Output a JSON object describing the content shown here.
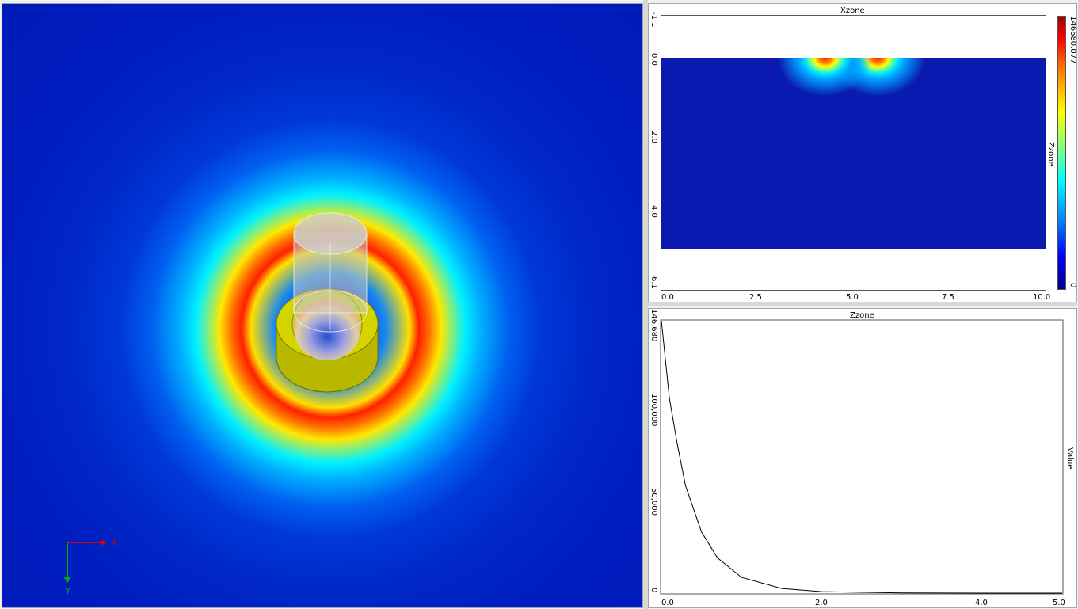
{
  "viewport": {
    "axis_x_label": "X",
    "axis_y_label": "Y",
    "colors": {
      "x_axis": "#e00000",
      "y_axis": "#00b000",
      "ring": "#d4d400"
    }
  },
  "top_plot": {
    "title": "Xzone",
    "right_axis_label": "Zzone",
    "x_ticks": [
      "0.0",
      "2.5",
      "5.0",
      "7.5",
      "10.0"
    ],
    "y_ticks": [
      "-1.1",
      "0.0",
      "2.0",
      "4.0",
      "6.1"
    ],
    "colorbar_max": "146680.077",
    "colorbar_min": "0"
  },
  "bottom_plot": {
    "title": "Zzone",
    "ylabel": "Value",
    "x_ticks": [
      "0.0",
      "2.0",
      "4.0",
      "5.0"
    ],
    "y_ticks": [
      "146,680",
      "100,000",
      "50,000",
      "0"
    ]
  },
  "chart_data": {
    "type": "line",
    "title": "Zzone",
    "ylabel": "Value",
    "xlim": [
      0,
      5
    ],
    "ylim": [
      0,
      146680
    ],
    "x": [
      0,
      0.1,
      0.2,
      0.3,
      0.5,
      0.7,
      1.0,
      1.5,
      2.0,
      3.0,
      4.0,
      5.0
    ],
    "y": [
      146680,
      105000,
      80000,
      58000,
      33000,
      19000,
      8500,
      2500,
      800,
      80,
      10,
      0
    ]
  }
}
